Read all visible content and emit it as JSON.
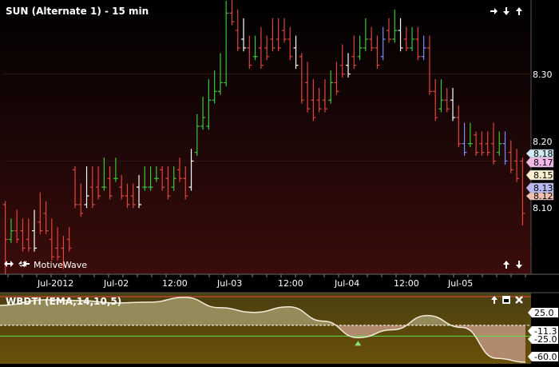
{
  "main_chart": {
    "title": "SUN (Alternate 1) - 15 min",
    "watermark": "MotiveWave",
    "y_ticks": [
      "8.30",
      "8.20",
      "8.10"
    ],
    "price_tags": [
      {
        "label": "8.18",
        "bg": "#cfe9f5"
      },
      {
        "label": "8.17",
        "bg": "#f4b8e8"
      },
      {
        "label": "8.15",
        "bg": "#f8f0cf"
      },
      {
        "label": "8.13",
        "bg": "#b7b9f0"
      },
      {
        "label": "8.12",
        "bg": "#f2c0b0"
      }
    ]
  },
  "time_axis": {
    "labels": [
      "Jul-2012",
      "Jul-02",
      "12:00",
      "Jul-03",
      "12:00",
      "Jul-04",
      "12:00",
      "Jul-05"
    ]
  },
  "indicator": {
    "title": "WBDTI (EMA,14,10,5)",
    "y_labels": [
      "25.0",
      "-11.3",
      "-25.0",
      "-60.0"
    ]
  },
  "chart_data": {
    "type": "ohlc",
    "title": "SUN (Alternate 1) - 15 min",
    "ylim": [
      8.07,
      8.385
    ],
    "y_ticks": [
      8.3,
      8.2,
      8.1
    ],
    "bars": [
      [
        8.15,
        8.07,
        8.11
      ],
      [
        8.11,
        8.13,
        8.12
      ],
      [
        8.12,
        8.14,
        8.11
      ],
      [
        8.12,
        8.13,
        8.1
      ],
      [
        8.11,
        8.13,
        8.1
      ],
      [
        8.12,
        8.14,
        8.1
      ],
      [
        8.13,
        8.16,
        8.12
      ],
      [
        8.14,
        8.15,
        8.12
      ],
      [
        8.11,
        8.13,
        8.09
      ],
      [
        8.1,
        8.12,
        8.09
      ],
      [
        8.1,
        8.11,
        8.08
      ],
      [
        8.11,
        8.12,
        8.1
      ],
      [
        8.19,
        8.18,
        8.15
      ],
      [
        8.15,
        8.17,
        8.14
      ],
      [
        8.15,
        8.19,
        8.16
      ],
      [
        8.17,
        8.19,
        8.15
      ],
      [
        8.17,
        8.19,
        8.16
      ],
      [
        8.17,
        8.2,
        8.17
      ],
      [
        8.18,
        8.19,
        8.16
      ],
      [
        8.18,
        8.2,
        8.18
      ],
      [
        8.17,
        8.18,
        8.16
      ],
      [
        8.16,
        8.17,
        8.15
      ],
      [
        8.16,
        8.17,
        8.15
      ],
      [
        8.17,
        8.18,
        8.15
      ],
      [
        8.17,
        8.19,
        8.17
      ],
      [
        8.17,
        8.19,
        8.17
      ],
      [
        8.18,
        8.19,
        8.18
      ],
      [
        8.19,
        8.18,
        8.17
      ],
      [
        8.18,
        8.19,
        8.16
      ],
      [
        8.17,
        8.19,
        8.18
      ],
      [
        8.19,
        8.2,
        8.18
      ],
      [
        8.18,
        8.19,
        8.16
      ],
      [
        8.17,
        8.21,
        8.2
      ],
      [
        8.21,
        8.25,
        8.24
      ],
      [
        8.24,
        8.27,
        8.25
      ],
      [
        8.24,
        8.29,
        8.27
      ],
      [
        8.27,
        8.3,
        8.28
      ],
      [
        8.28,
        8.32,
        8.29
      ],
      [
        8.29,
        8.38,
        8.37
      ],
      [
        8.37,
        8.39,
        8.36
      ],
      [
        8.35,
        8.37,
        8.33
      ],
      [
        8.34,
        8.36,
        8.33
      ],
      [
        8.33,
        8.34,
        8.31
      ],
      [
        8.32,
        8.34,
        8.32
      ],
      [
        8.33,
        8.35,
        8.31
      ],
      [
        8.33,
        8.34,
        8.32
      ],
      [
        8.34,
        8.36,
        8.33
      ],
      [
        8.34,
        8.36,
        8.33
      ],
      [
        8.35,
        8.36,
        8.34
      ],
      [
        8.34,
        8.35,
        8.32
      ],
      [
        8.33,
        8.34,
        8.31
      ],
      [
        8.32,
        8.31,
        8.27
      ],
      [
        8.29,
        8.31,
        8.26
      ],
      [
        8.27,
        8.29,
        8.25
      ],
      [
        8.27,
        8.28,
        8.26
      ],
      [
        8.27,
        8.29,
        8.26
      ],
      [
        8.27,
        8.3,
        8.29
      ],
      [
        8.29,
        8.31,
        8.28
      ],
      [
        8.31,
        8.33,
        8.3
      ],
      [
        8.31,
        8.32,
        8.3
      ],
      [
        8.32,
        8.34,
        8.31
      ],
      [
        8.32,
        8.34,
        8.33
      ],
      [
        8.33,
        8.36,
        8.34
      ],
      [
        8.34,
        8.35,
        8.33
      ],
      [
        8.33,
        8.34,
        8.31
      ],
      [
        8.32,
        8.35,
        8.34
      ],
      [
        8.35,
        8.36,
        8.34
      ],
      [
        8.34,
        8.37,
        8.35
      ],
      [
        8.35,
        8.36,
        8.33
      ],
      [
        8.34,
        8.35,
        8.33
      ],
      [
        8.33,
        8.35,
        8.34
      ],
      [
        8.34,
        8.35,
        8.32
      ],
      [
        8.32,
        8.34,
        8.33
      ],
      [
        8.33,
        8.34,
        8.28
      ],
      [
        8.28,
        8.29,
        8.25
      ],
      [
        8.26,
        8.29,
        8.27
      ],
      [
        8.27,
        8.28,
        8.26
      ],
      [
        8.27,
        8.28,
        8.25
      ],
      [
        8.25,
        8.26,
        8.22
      ],
      [
        8.22,
        8.24,
        8.21
      ],
      [
        8.22,
        8.24,
        8.22
      ],
      [
        8.23,
        8.22,
        8.21
      ],
      [
        8.22,
        8.23,
        8.21
      ],
      [
        8.22,
        8.23,
        8.21
      ],
      [
        8.22,
        8.24,
        8.2
      ],
      [
        8.21,
        8.23,
        8.22
      ],
      [
        8.22,
        8.23,
        8.2
      ],
      [
        8.21,
        8.22,
        8.19
      ],
      [
        8.2,
        8.21,
        8.18
      ],
      [
        8.2,
        8.13,
        8.14
      ]
    ]
  },
  "indicator_data": {
    "type": "area",
    "ylim": [
      -60,
      30
    ],
    "levels": [
      25.0,
      -11.3,
      -25.0,
      -60.0
    ],
    "x": [
      0,
      8,
      14,
      20,
      26,
      32,
      38,
      44,
      50,
      56,
      62,
      68,
      74,
      80,
      86,
      91
    ],
    "values": [
      14,
      21,
      20,
      17,
      18,
      24,
      11,
      5,
      12,
      -6,
      -27,
      -17,
      1,
      -14,
      -53,
      -58
    ]
  }
}
